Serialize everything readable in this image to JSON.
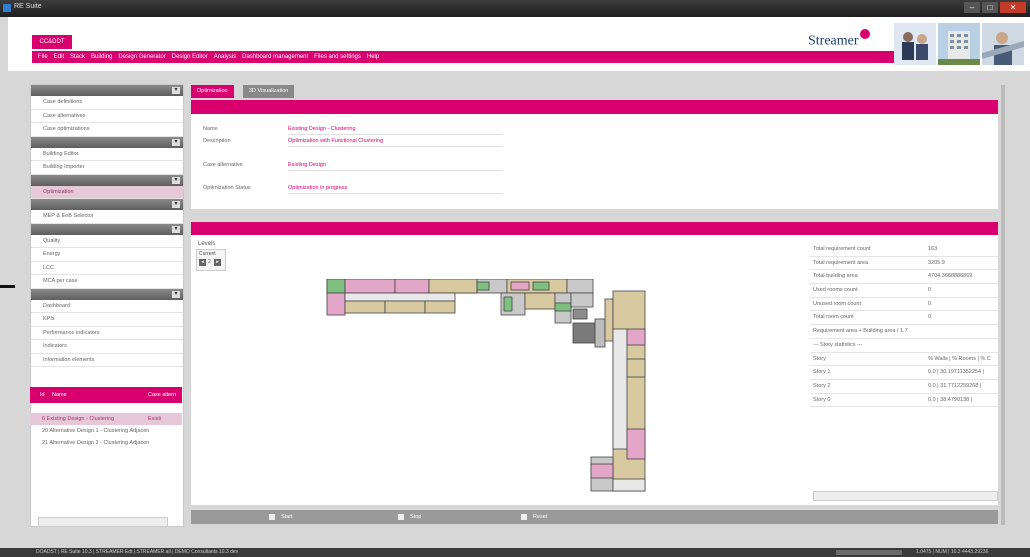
{
  "window": {
    "title": "RE Suite",
    "min": "–",
    "max": "□",
    "close": "✕"
  },
  "header": {
    "cc_button": "CC&DDT",
    "menu": [
      "File",
      "Edit",
      "Stack",
      "Building",
      "Design Generator",
      "Design Editor",
      "Analysis",
      "Dashboard management",
      "Files and settings",
      "Help"
    ],
    "logo": "Streamer"
  },
  "sidebar": {
    "toggle": "▾",
    "groups": [
      {
        "items": [
          "Case definitions",
          "Case alternatives",
          "Case optimizations"
        ]
      },
      {
        "items": [
          "Building Editor",
          "Building Importer"
        ]
      },
      {
        "items": [
          "Optimization"
        ],
        "selected": 0
      },
      {
        "items": [
          "MEP & EeB Selector"
        ]
      },
      {
        "items": [
          "Quality",
          "Energy",
          "LCC",
          "MCA per case"
        ]
      },
      {
        "items": [
          "Dashboard",
          "KPIs",
          "Performance indicators",
          "Indicators",
          "Information elements"
        ]
      }
    ]
  },
  "cases": {
    "headers": {
      "id": "Id",
      "name": "Name",
      "alt": "Case altern"
    },
    "rows": [
      {
        "text": "6   Existing Design - Clustering",
        "alt": "Existi",
        "selected": true
      },
      {
        "text": "20  Alternative Design 1 - Clustering Adjacen",
        "alt": ""
      },
      {
        "text": "21  Alternative Design 2 - Clustering Adjacen",
        "alt": ""
      }
    ]
  },
  "tabs": {
    "optimization": "Optimization",
    "visualization": "3D Visualization"
  },
  "info": {
    "name_label": "Name",
    "name_value": "Existing Design - Clustering",
    "desc_label": "Description",
    "desc_value": "Optimization with Functional Clustering",
    "case_label": "Case alternative",
    "case_value": "Existing Design",
    "status_label": "Optimization Status",
    "status_value": "Optimization in progress"
  },
  "viz": {
    "levels_label": "Levels",
    "current_label": "Current",
    "level_value": "2"
  },
  "stats": [
    {
      "k": "Total requirement count",
      "v": "163"
    },
    {
      "k": "Total requirement area",
      "v": "3205.9"
    },
    {
      "k": "Total building area",
      "v": "4704.3668886869"
    },
    {
      "k": "Used rooms count",
      "v": "0"
    },
    {
      "k": "Unused room count",
      "v": "0"
    },
    {
      "k": "Total room count",
      "v": "0"
    },
    {
      "k": "Requirement area + Building area / 1.7",
      "v": ""
    },
    {
      "k": "--- Story statistics ---",
      "v": ""
    },
    {
      "k": "Story",
      "v": "% Walls | % Rooms | % C"
    },
    {
      "k": "Story 1",
      "v": "0.0 | 30.19711352254 |"
    },
    {
      "k": "Story 2",
      "v": "0.0 | 31.7712259268 |"
    },
    {
      "k": "Story 0",
      "v": "0.0 | 38.4790138 |"
    }
  ],
  "controls": {
    "start": "Start",
    "stop": "Stop",
    "reset": "Reset"
  },
  "status": {
    "left": "DOADST | RE Suite 10.3 | STREAMER Edt | STREAMER all | DEMO Consultants 10.3 dev",
    "right": "1.0475 | NUM | 10.3 4443.29236"
  },
  "colors": {
    "accent": "#d8006e",
    "selected": "#e6c8d8"
  }
}
